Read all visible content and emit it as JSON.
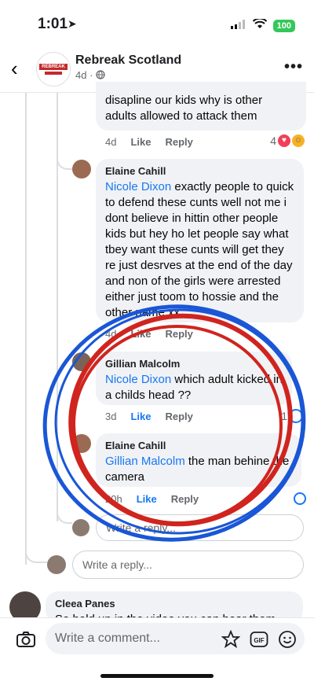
{
  "status": {
    "time": "1:01",
    "battery": "100"
  },
  "header": {
    "page_name": "Rebreak Scotland",
    "meta": "4d ·",
    "logo_text": "REBREAK NEWS"
  },
  "comments": [
    {
      "id": "c0",
      "text_tail": "disapline our kids why is other adults allowed to attack them",
      "time": "4d",
      "like": "Like",
      "reply": "Reply",
      "reaction_count": "4"
    },
    {
      "id": "c1",
      "author": "Elaine Cahill",
      "mention": "Nicole Dixon",
      "text": " exactly people to quick to defend these cunts well not me i dont believe in hittin other people kids but hey ho let people say what tbey want these cunts will get they re just desrves at the end of the day and non of the girls were arrested either just toom to hossie and the other name xx",
      "time": "4d",
      "like": "Like",
      "reply": "Reply"
    },
    {
      "id": "c2",
      "author": "Gillian Malcolm",
      "mention": "Nicole Dixon",
      "text": " which adult kicked in a childs head ??",
      "time": "3d",
      "like": "Like",
      "reply": "Reply",
      "reaction_count": "1"
    },
    {
      "id": "c3",
      "author": "Elaine Cahill",
      "mention": "Gillian Malcolm",
      "text": " the man behine the camera",
      "time": "20h",
      "like": "Like",
      "reply": "Reply"
    },
    {
      "id": "c4",
      "author": "Cleea Panes",
      "text": "So hold up in the video you can hear them"
    }
  ],
  "reply_placeholder": "Write a reply...",
  "comment_placeholder": "Write a comment...",
  "icons": [
    "back-icon",
    "globe-icon",
    "more-icon",
    "camera-icon",
    "sticker-icon",
    "gif-icon",
    "emoji-icon",
    "location-arrow-icon",
    "wifi-icon",
    "signal-icon"
  ],
  "colors": {
    "accent": "#1877f2",
    "ink_red": "#d0241f",
    "ink_blue": "#1a56d6"
  }
}
